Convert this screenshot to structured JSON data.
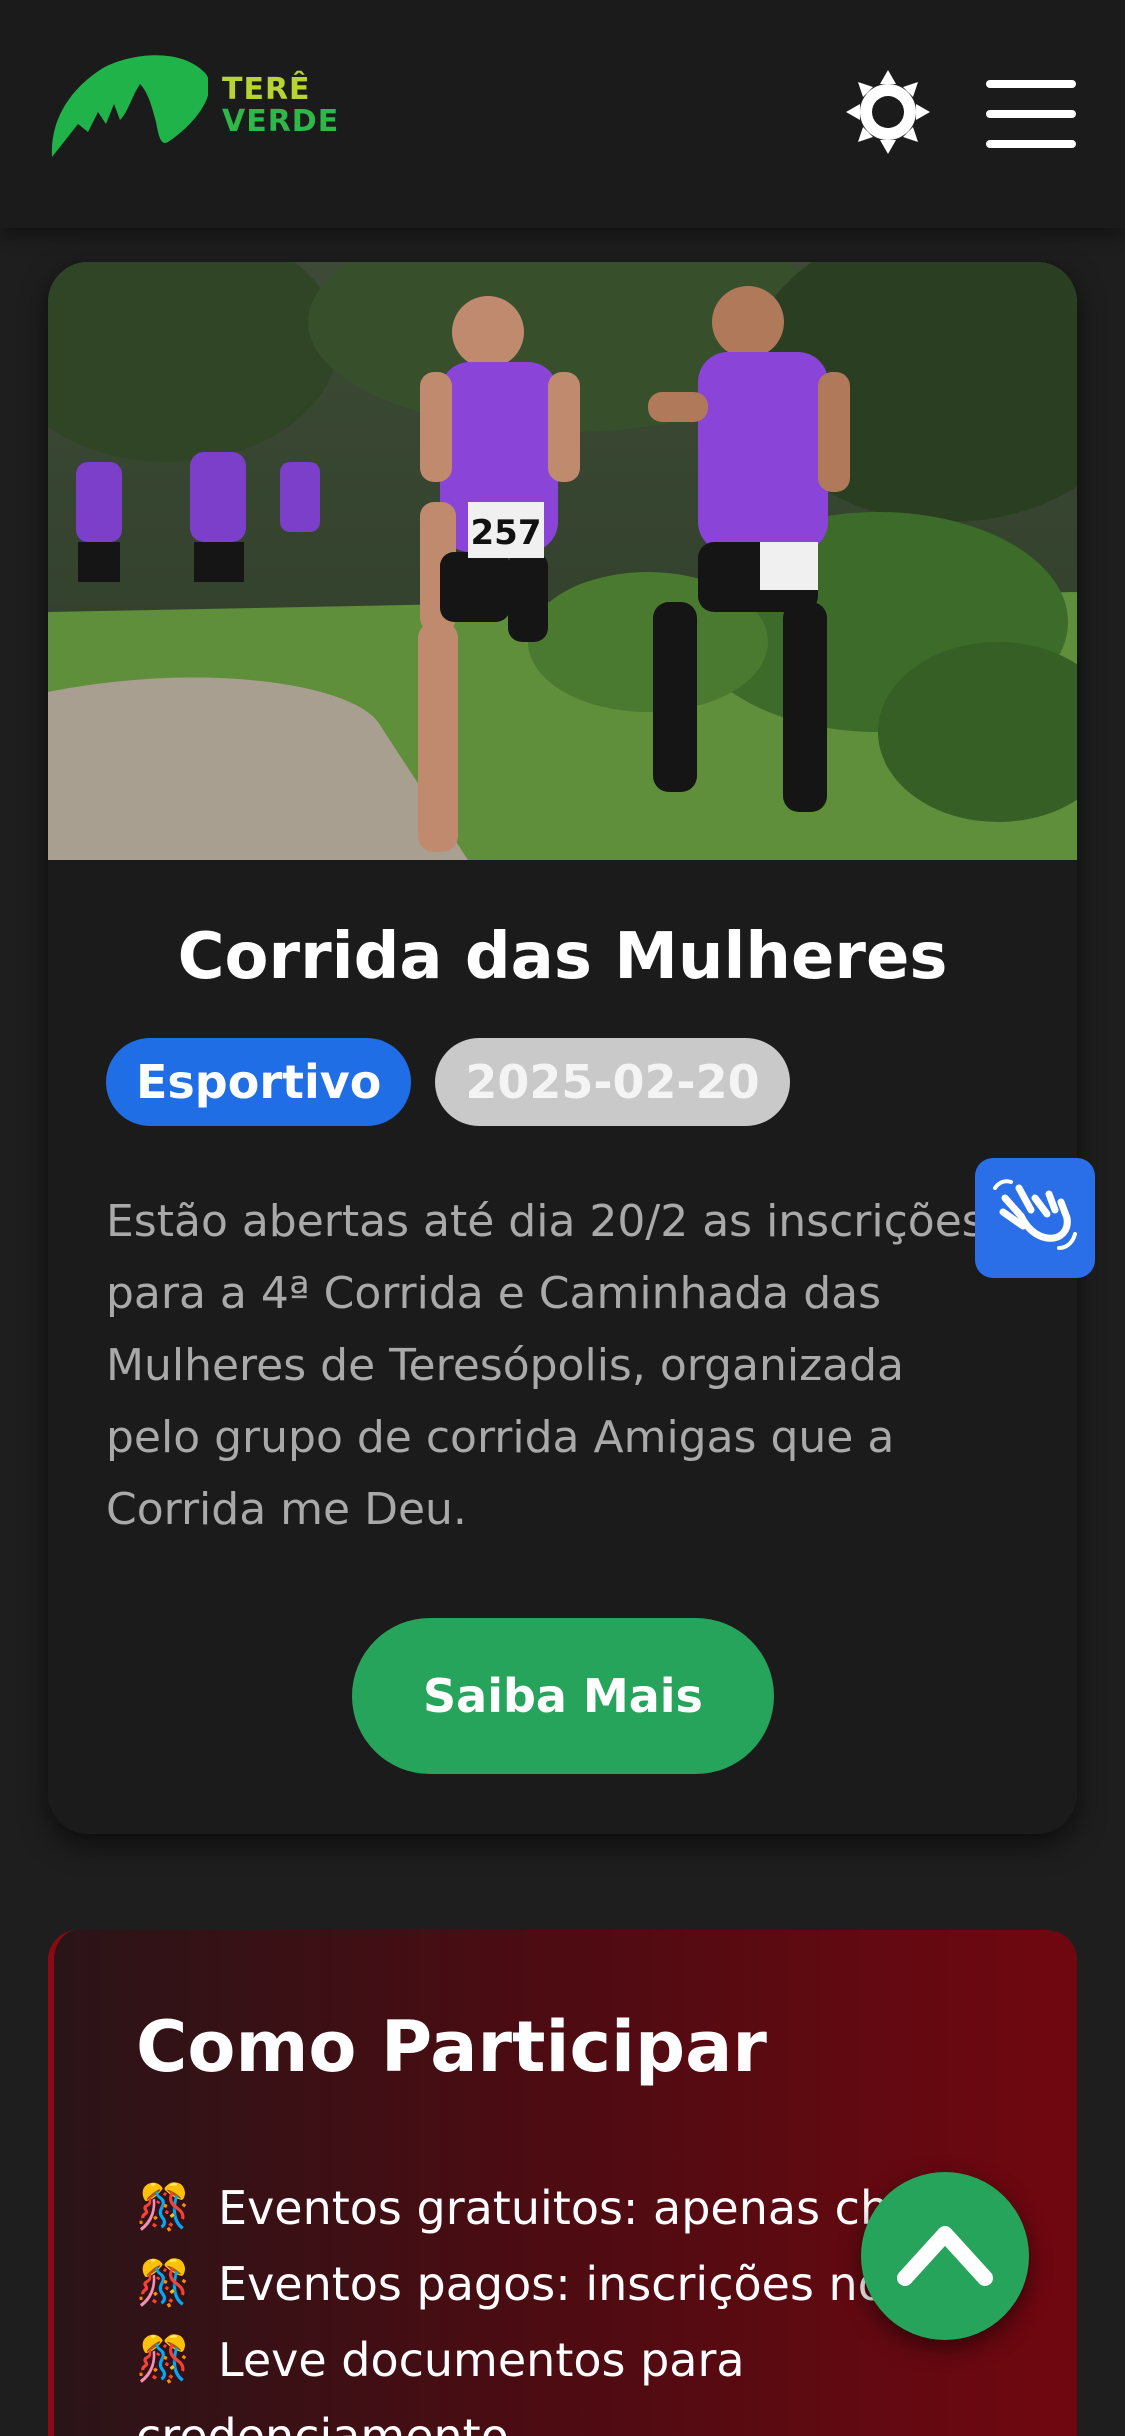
{
  "header": {
    "logo": {
      "line1": "TERÊ",
      "line2": "VERDE"
    },
    "theme_toggle_icon": "sun-icon",
    "menu_icon": "hamburger-menu-icon"
  },
  "event_card": {
    "title": "Corrida das Mulheres",
    "category": "Esportivo",
    "date": "2025-02-20",
    "description_lines": [
      "Estão abertas até dia 20/2 as inscrições",
      "para a 4ª Corrida e Caminhada das",
      "Mulheres de Teresópolis, organizada",
      "pelo grupo de corrida Amigas que a",
      "Corrida me Deu."
    ],
    "button_label": "Saiba Mais"
  },
  "accessibility_button": {
    "icon": "sign-language-hands-icon"
  },
  "participate": {
    "title": "Como Participar",
    "items": [
      {
        "emoji": "🎊",
        "text": "Eventos gratuitos: apenas che"
      },
      {
        "emoji": "🎊",
        "text": "Eventos pagos: inscrições no"
      },
      {
        "emoji": "🎊",
        "text": "Leve documentos para"
      },
      {
        "emoji": "",
        "text": "credenciamento"
      }
    ]
  },
  "back_to_top": {
    "icon": "chevron-up-icon"
  },
  "colors": {
    "background": "#1e1e1f",
    "accent_green": "#26a45b",
    "badge_blue": "#1f6ee6",
    "badge_gray": "#c9c9c9",
    "participate_red": "#700710"
  }
}
